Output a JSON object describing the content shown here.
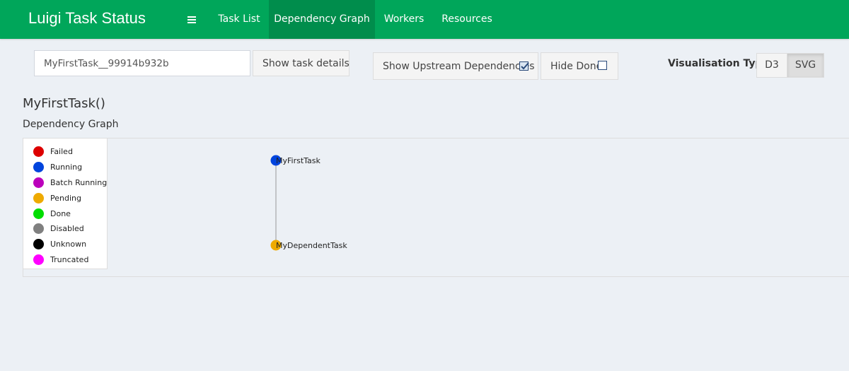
{
  "app": {
    "title": "Luigi Task Status"
  },
  "nav": {
    "menu_icon": "hamburger-menu-icon",
    "tabs": [
      {
        "label": "Task List",
        "active": false
      },
      {
        "label": "Dependency Graph",
        "active": true
      },
      {
        "label": "Workers",
        "active": false
      },
      {
        "label": "Resources",
        "active": false
      }
    ]
  },
  "controls": {
    "task_input_value": "MyFirstTask__99914b932b",
    "show_details_label": "Show task details",
    "show_upstream_label": "Show Upstream Dependencies",
    "show_upstream_checked": true,
    "hide_done_label": "Hide Done",
    "hide_done_checked": false,
    "vis_type_label": "Visualisation Type",
    "vis_options": [
      {
        "label": "D3",
        "active": false
      },
      {
        "label": "SVG",
        "active": true
      }
    ]
  },
  "task": {
    "title": "MyFirstTask()",
    "section_label": "Dependency Graph"
  },
  "legend": [
    {
      "label": "Failed",
      "color": "#dd0000"
    },
    {
      "label": "Running",
      "color": "#0044dd"
    },
    {
      "label": "Batch Running",
      "color": "#bb00bb"
    },
    {
      "label": "Pending",
      "color": "#eeaa00"
    },
    {
      "label": "Done",
      "color": "#00dd00"
    },
    {
      "label": "Disabled",
      "color": "#808080"
    },
    {
      "label": "Unknown",
      "color": "#000000"
    },
    {
      "label": "Truncated",
      "color": "#ff00ff"
    }
  ],
  "graph": {
    "nodes": [
      {
        "name": "MyFirstTask",
        "status": "Running",
        "color": "#0044dd"
      },
      {
        "name": "MyDependentTask",
        "status": "Pending",
        "color": "#eeaa00"
      }
    ],
    "edges": [
      {
        "from": "MyFirstTask",
        "to": "MyDependentTask"
      }
    ]
  }
}
